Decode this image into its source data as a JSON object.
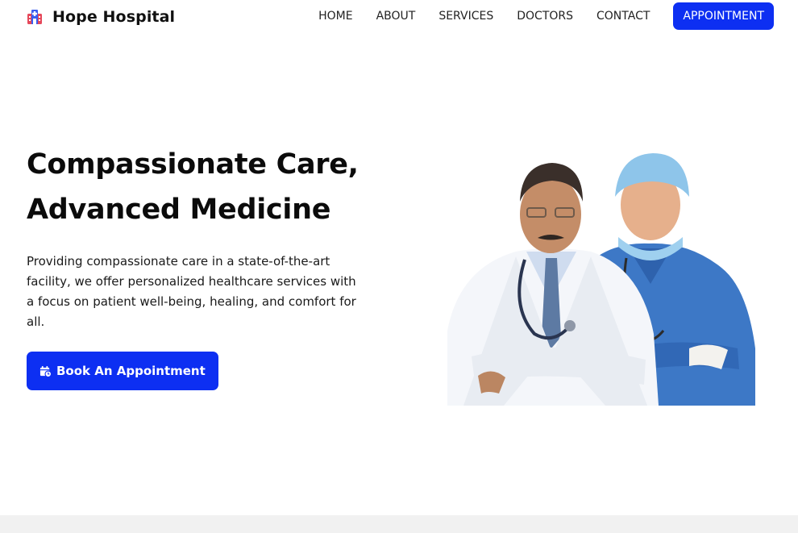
{
  "brand": {
    "name": "Hope Hospital",
    "icon": "hospital-building-icon"
  },
  "nav": {
    "items": [
      "HOME",
      "ABOUT",
      "SERVICES",
      "DOCTORS",
      "CONTACT"
    ],
    "cta": "APPOINTMENT"
  },
  "hero": {
    "title_line1": "Compassionate Care,",
    "title_line2": "Advanced Medicine",
    "text": "Providing compassionate care in a state-of-the-art facility, we offer personalized healthcare services with a focus on patient well-being, healing, and comfort for all.",
    "button_label": "Book An Appointment",
    "button_icon": "calendar-clock-icon"
  },
  "image": {
    "subject": "doctors-photo"
  },
  "colors": {
    "accent": "#0d2ff2",
    "text": "#111111",
    "footer_bg": "#f1f1f1"
  }
}
